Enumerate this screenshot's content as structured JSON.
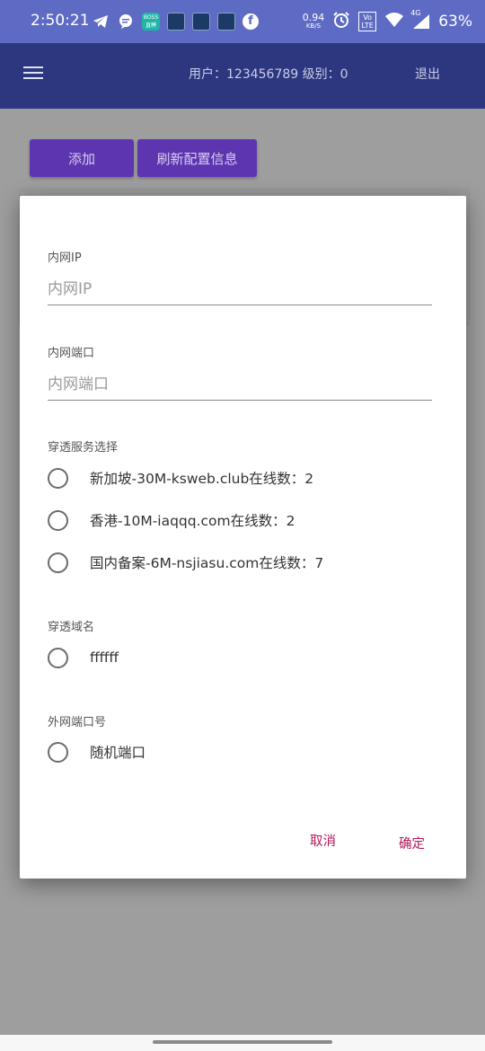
{
  "status_bar": {
    "time": "2:50:21",
    "boss_app_label": "BOSS\n直聘",
    "net_speed": "0.94",
    "net_unit": "KB/S",
    "volte": "Vo LTE",
    "signal": "4G",
    "battery": "63%",
    "icons": [
      "telegram-icon",
      "message-bubble-icon",
      "boss-app-icon",
      "app-icon",
      "app-icon",
      "app-icon",
      "facebook-icon",
      "alarm-icon",
      "wifi-icon",
      "signal-icon"
    ]
  },
  "app_bar": {
    "user_info": "用户：123456789 级别：0",
    "logout": "退出"
  },
  "toolbar": {
    "add": "添加",
    "refresh": "刷新配置信息"
  },
  "dialog": {
    "intranet_ip_label": "内网IP",
    "intranet_ip_placeholder": "内网IP",
    "intranet_port_label": "内网端口",
    "intranet_port_placeholder": "内网端口",
    "service_label": "穿透服务选择",
    "services": [
      "新加坡-30M-ksweb.club在线数：2",
      "香港-10M-iaqqq.com在线数：2",
      "国内备案-6M-nsjiasu.com在线数：7"
    ],
    "domain_label": "穿透域名",
    "domains": [
      "ffffff"
    ],
    "external_port_label": "外网端口号",
    "external_ports": [
      "随机端口"
    ],
    "cancel": "取消",
    "confirm": "确定"
  },
  "colors": {
    "status_bar": "#5e6bc4",
    "app_bar": "#2d3780",
    "primary_button": "#5e35b1",
    "dialog_action": "#b0185a"
  }
}
